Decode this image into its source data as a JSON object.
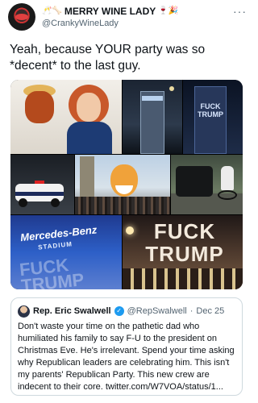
{
  "tweet": {
    "display_name": "MERRY WINE LADY",
    "display_name_prefix_emoji": "🥂🦴",
    "display_name_suffix_emoji": "🍷🎉",
    "handle": "@CrankyWineLady",
    "more_label": "···",
    "text": "Yeah, because YOUR party was so *decent* to the last guy."
  },
  "media": {
    "tile_projection_text": "FUCK TRUMP",
    "stadium_name": "Mercedes-Benz",
    "stadium_label": "STADIUM",
    "stadium_overlay_text": "FUCK TRUMP",
    "wall_text": "FUCK TRUMP"
  },
  "quote": {
    "name": "Rep. Eric Swalwell",
    "verified_mark": "✓",
    "handle": "@RepSwalwell",
    "separator": "·",
    "date": "Dec 25",
    "body": "Don't waste your time on the pathetic dad who humiliated his family to say F-U to the president on Christmas Eve. He's irrelevant. Spend your time asking why Republican leaders are celebrating him. This isn't my parents' Republican Party. This new crew are indecent to their core. twitter.com/W7VOA/status/1..."
  }
}
